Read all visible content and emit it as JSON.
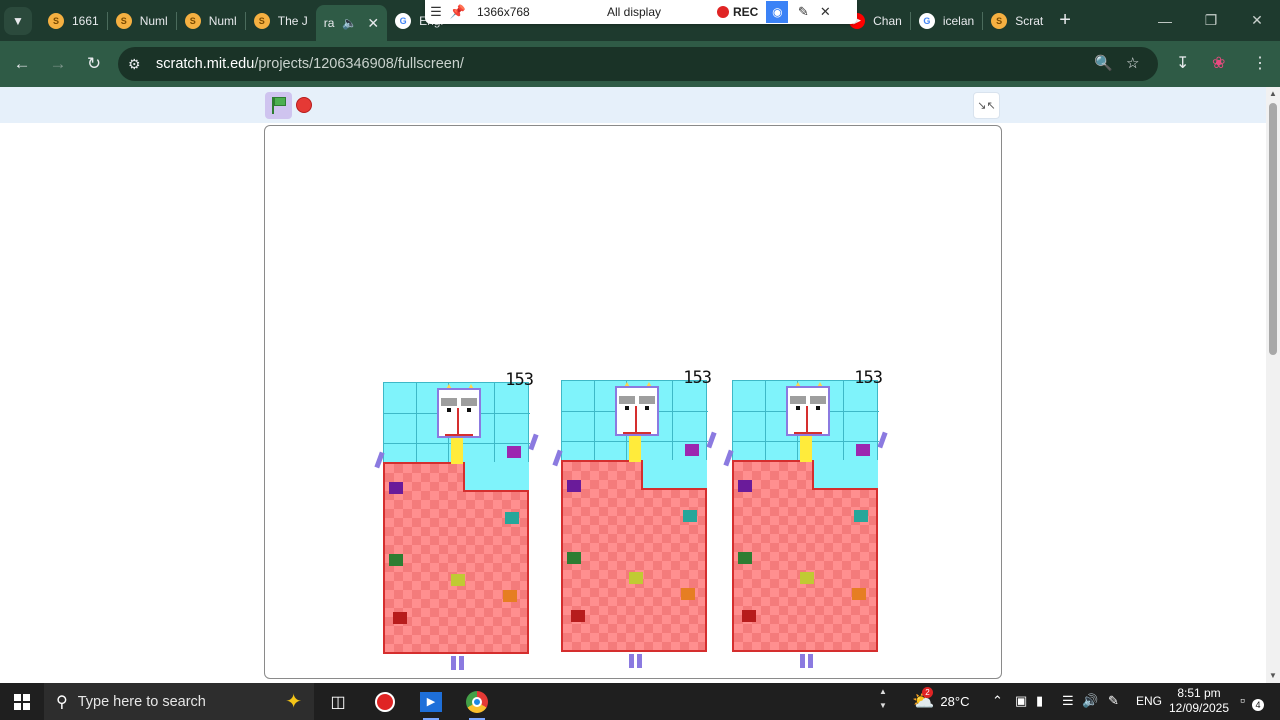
{
  "browser": {
    "tabs": [
      {
        "label": "1661",
        "favicon": "scratch-icon",
        "active": false
      },
      {
        "label": "Numl",
        "favicon": "scratch-icon",
        "active": false
      },
      {
        "label": "Numl",
        "favicon": "scratch-icon",
        "active": false
      },
      {
        "label": "The J",
        "favicon": "scratch-icon",
        "active": false
      },
      {
        "label": "ra",
        "favicon": "scratch-icon",
        "active": true
      },
      {
        "label": "Engl",
        "favicon": "google-icon",
        "active": false
      },
      {
        "label": "Chan",
        "favicon": "youtube-icon",
        "active": false
      },
      {
        "label": "icelan",
        "favicon": "google-icon",
        "active": false
      },
      {
        "label": "Scrat",
        "favicon": "scratch-icon",
        "active": false
      }
    ],
    "new_tab_label": "+",
    "url_host": "scratch.mit.edu",
    "url_path": "/projects/1206346908/fullscreen/"
  },
  "recorder": {
    "resolution": "1366x768",
    "display": "All display",
    "rec_label": "REC"
  },
  "scratch": {
    "sprites": [
      {
        "number": "153"
      },
      {
        "number": "153"
      },
      {
        "number": "153"
      }
    ],
    "colors": {
      "body": "#ff8f8f",
      "top": "#7ff3fb",
      "outline": "#d52e2e",
      "accent": "#8b7ae0"
    }
  },
  "taskbar": {
    "search_placeholder": "Type here to search",
    "temperature": "28°C",
    "weather_badge": "2",
    "language": "ENG",
    "time": "8:51 pm",
    "date": "12/09/2025",
    "notification_count": "4"
  }
}
